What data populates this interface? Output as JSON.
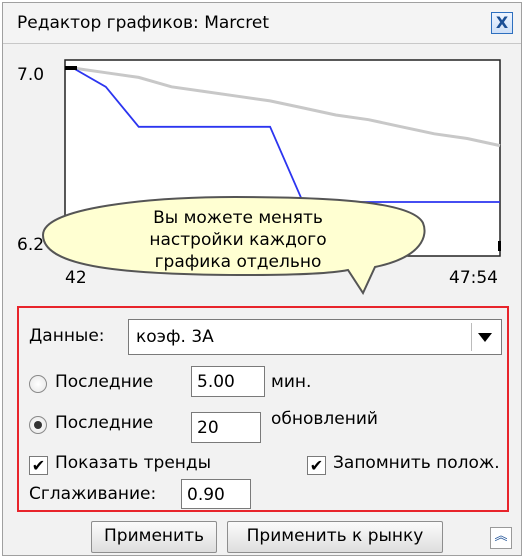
{
  "window": {
    "title": "Редактор графиков: Marcret",
    "close_label": "X"
  },
  "chart": {
    "y_top_label": "7.0",
    "y_bottom_label": "6.2",
    "x_left_label": "42",
    "x_right_label": "47:54"
  },
  "chart_data": {
    "type": "line",
    "ylim": [
      6.2,
      7.0
    ],
    "series": [
      {
        "color": "#c8c8c8",
        "values": [
          7.0,
          6.98,
          6.96,
          6.92,
          6.9,
          6.88,
          6.86,
          6.83,
          6.8,
          6.78,
          6.75,
          6.72,
          6.7,
          6.67
        ]
      },
      {
        "color": "#2c35f0",
        "values": [
          7.0,
          6.92,
          6.75,
          6.75,
          6.75,
          6.75,
          6.75,
          6.43,
          6.43,
          6.43,
          6.43,
          6.43,
          6.43,
          6.43
        ]
      }
    ]
  },
  "callout": {
    "text_line1": "Вы можете менять",
    "text_line2": "настройки каждого",
    "text_line3": "графика отдельно"
  },
  "settings": {
    "data_label": "Данные:",
    "data_value": "коэф. 3А",
    "last1_label": "Последние",
    "last1_value": "5.00",
    "last1_unit": "мин.",
    "last2_label": "Последние",
    "last2_value": "20",
    "last2_unit": "обновлений",
    "show_trends_label": "Показать тренды",
    "show_trends_checked": true,
    "remember_pos_label": "Запомнить полож.",
    "remember_pos_checked": true,
    "smoothing_label": "Сглаживание:",
    "smoothing_value": "0.90"
  },
  "buttons": {
    "apply": "Применить",
    "apply_market": "Применить к рынку"
  },
  "icons": {
    "collapse": "double-chevron-up-icon",
    "dropdown": "triangle-down-icon"
  }
}
